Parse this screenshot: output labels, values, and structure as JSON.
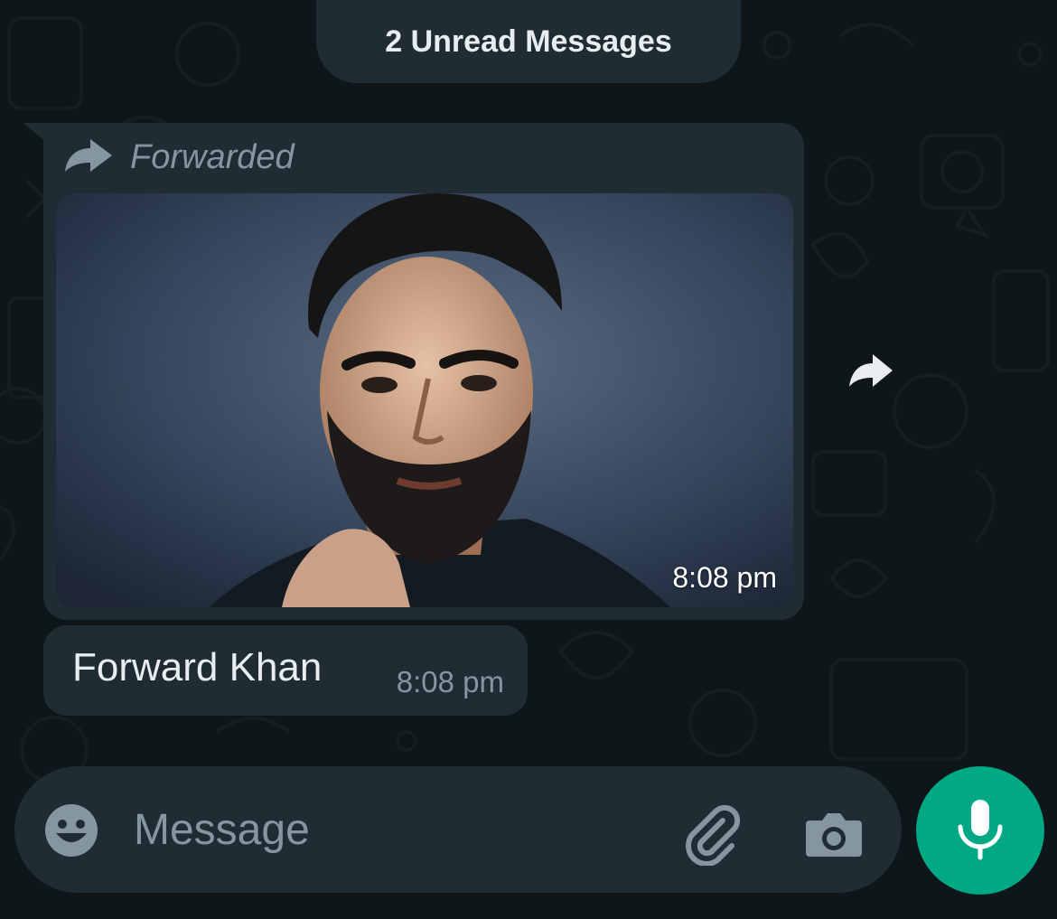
{
  "unread_banner": {
    "label": "2 Unread Messages"
  },
  "messages": [
    {
      "forwarded_label": "Forwarded",
      "forward_icon": "forward-arrow-icon",
      "media": "photo-portrait",
      "time": "8:08 pm"
    },
    {
      "text": "Forward Khan",
      "time": "8:08 pm"
    }
  ],
  "share_icon": "share-forward-icon",
  "composer": {
    "placeholder": "Message",
    "value": "",
    "emoji_icon": "emoji-icon",
    "attach_icon": "paperclip-icon",
    "camera_icon": "camera-icon"
  },
  "mic_icon": "microphone-icon",
  "colors": {
    "background": "#0e1619",
    "bubble": "#1f2c33",
    "accent": "#00a884",
    "text_primary": "#e9edef",
    "text_secondary": "#8696a0"
  }
}
